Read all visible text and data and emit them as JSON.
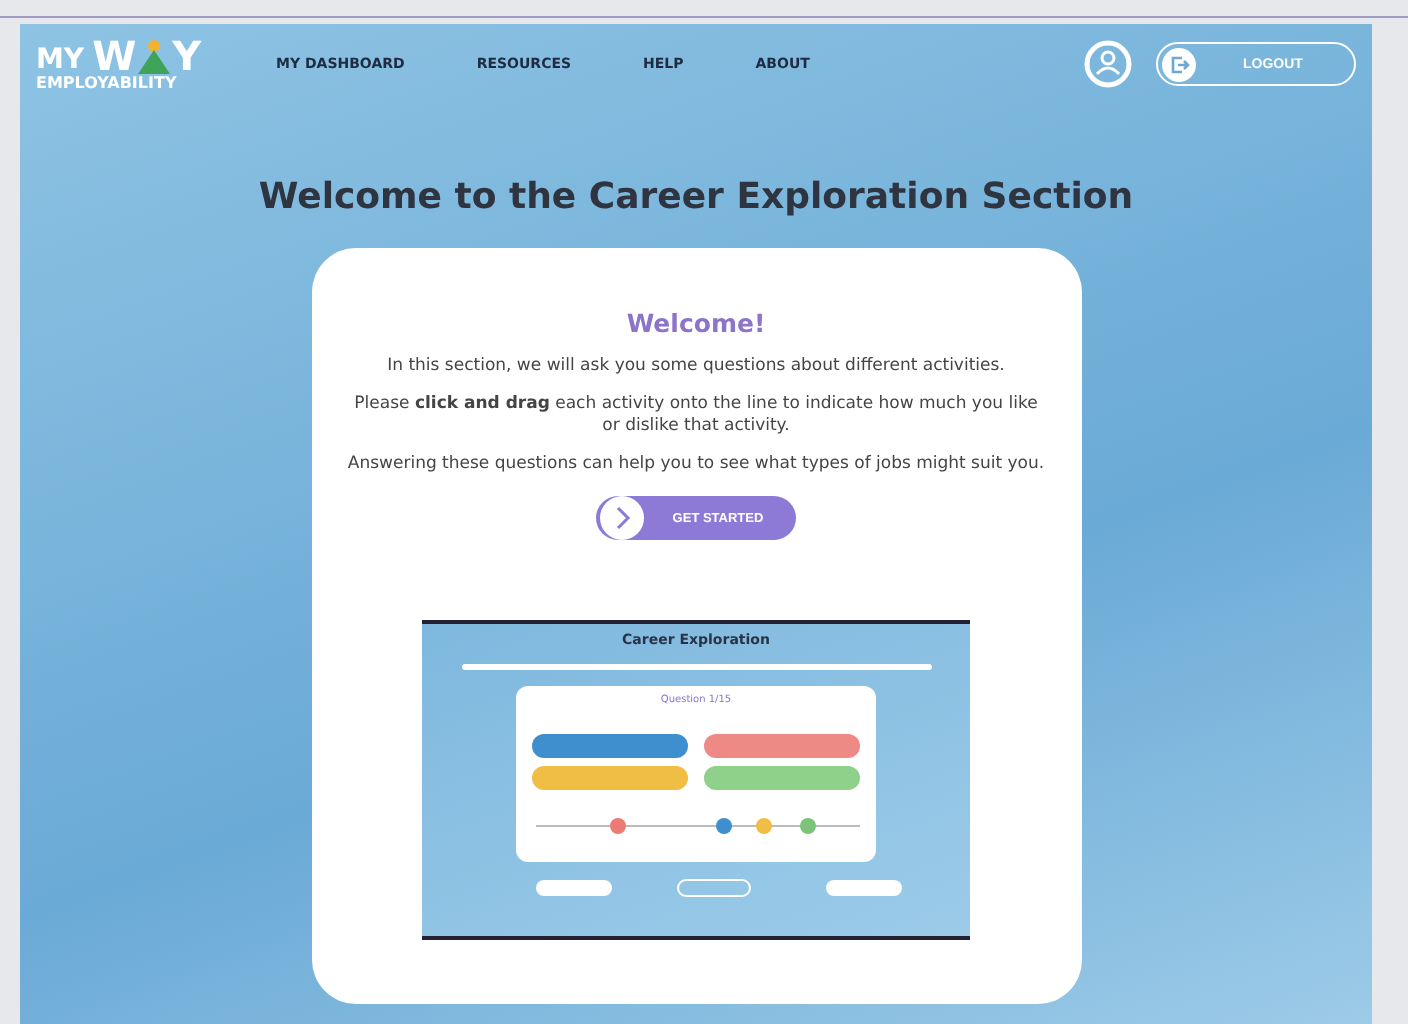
{
  "logo": {
    "line1": "MY",
    "line2": "W",
    "line3": "Y",
    "tagline": "EMPLOYABILITY"
  },
  "nav": [
    {
      "label": "MY DASHBOARD"
    },
    {
      "label": "RESOURCES"
    },
    {
      "label": "HELP"
    },
    {
      "label": "ABOUT"
    }
  ],
  "logout": {
    "label": "LOGOUT"
  },
  "heading": "Welcome to the Career Exploration Section",
  "card": {
    "title": "Welcome!",
    "paragraphs": [
      "In this section, we will ask you some questions about different activities.",
      "Please **click and drag** each activity onto the line to indicate how much you like or dislike that activity.",
      "Answering these questions can help you to see what types of jobs might suit you."
    ],
    "button": "GET STARTED",
    "preview": {
      "title": "Career Exploration",
      "question": "Question 1/15"
    }
  }
}
